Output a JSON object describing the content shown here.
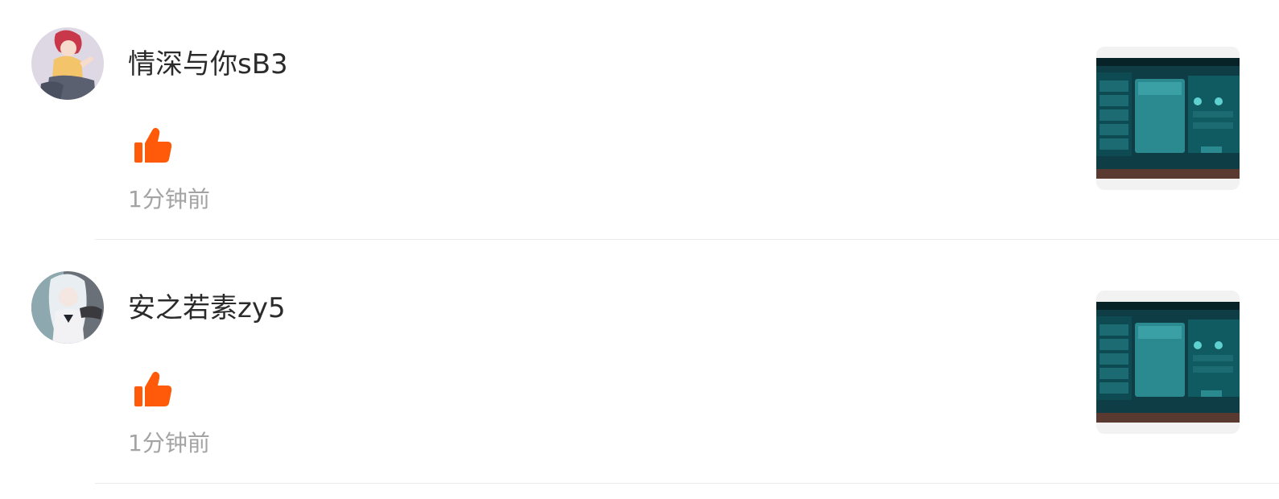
{
  "comments": [
    {
      "username": "情深与你sB3",
      "time": "1分钟前",
      "avatar_icon": "avatar-anime-red-hair",
      "like_icon": "thumbs-up-icon",
      "like_color": "#ff5a0a",
      "thumbnail": "game-screenshot-thumbnail"
    },
    {
      "username": "安之若素zy5",
      "time": "1分钟前",
      "avatar_icon": "avatar-anime-silver-hair",
      "like_icon": "thumbs-up-icon",
      "like_color": "#ff5a0a",
      "thumbnail": "game-screenshot-thumbnail"
    }
  ]
}
